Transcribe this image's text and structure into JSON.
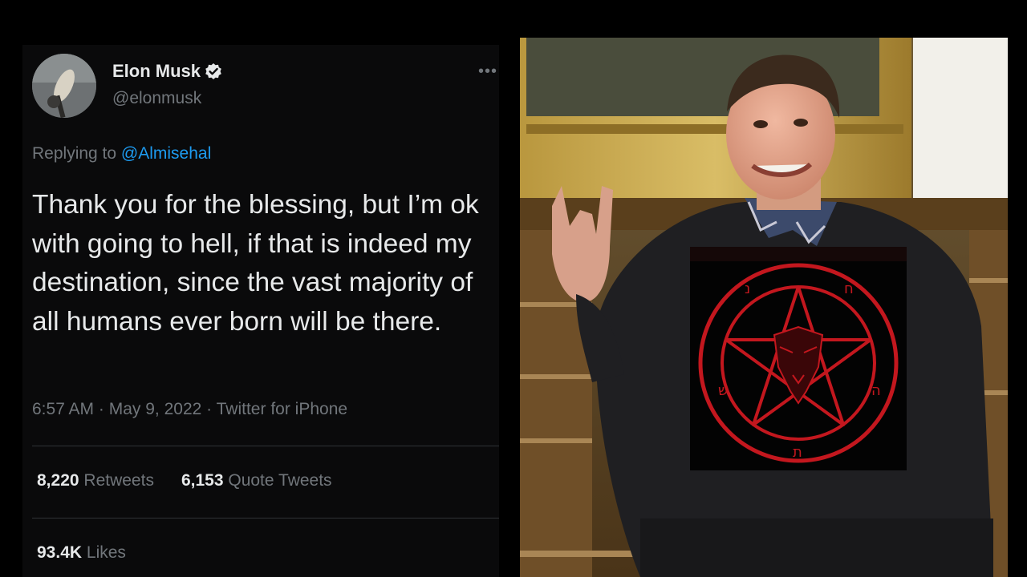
{
  "tweet": {
    "author": {
      "name": "Elon Musk",
      "handle": "@elonmusk",
      "verified": true
    },
    "more_icon": "•••",
    "reply": {
      "prefix": "Replying to",
      "mention": "@Almisehal"
    },
    "text": "Thank you for the blessing, but I’m ok with going to hell, if that is indeed my destination, since the vast majority of all humans ever born will be there.",
    "meta": {
      "time": "6:57 AM",
      "separator": "·",
      "date": "May 9, 2022",
      "source": "Twitter for iPhone"
    },
    "stats": {
      "retweets": {
        "count": "8,220",
        "label": "Retweets"
      },
      "quotes": {
        "count": "6,153",
        "label": "Quote Tweets"
      },
      "likes": {
        "count": "93.4K",
        "label": "Likes"
      }
    }
  },
  "photo": {
    "alt_icons": [
      "pentagram-icon",
      "hand-gesture"
    ],
    "overlay_glyphs": [
      "נ",
      "ח",
      "ש",
      "ה",
      "ת"
    ]
  },
  "colors": {
    "background": "#000000",
    "card": "#0a0a0b",
    "text_primary": "#e7e9ea",
    "text_secondary": "#71767b",
    "link": "#1d9bf0",
    "verified": "#1d9bf0",
    "pentagram": "#c3171e"
  }
}
